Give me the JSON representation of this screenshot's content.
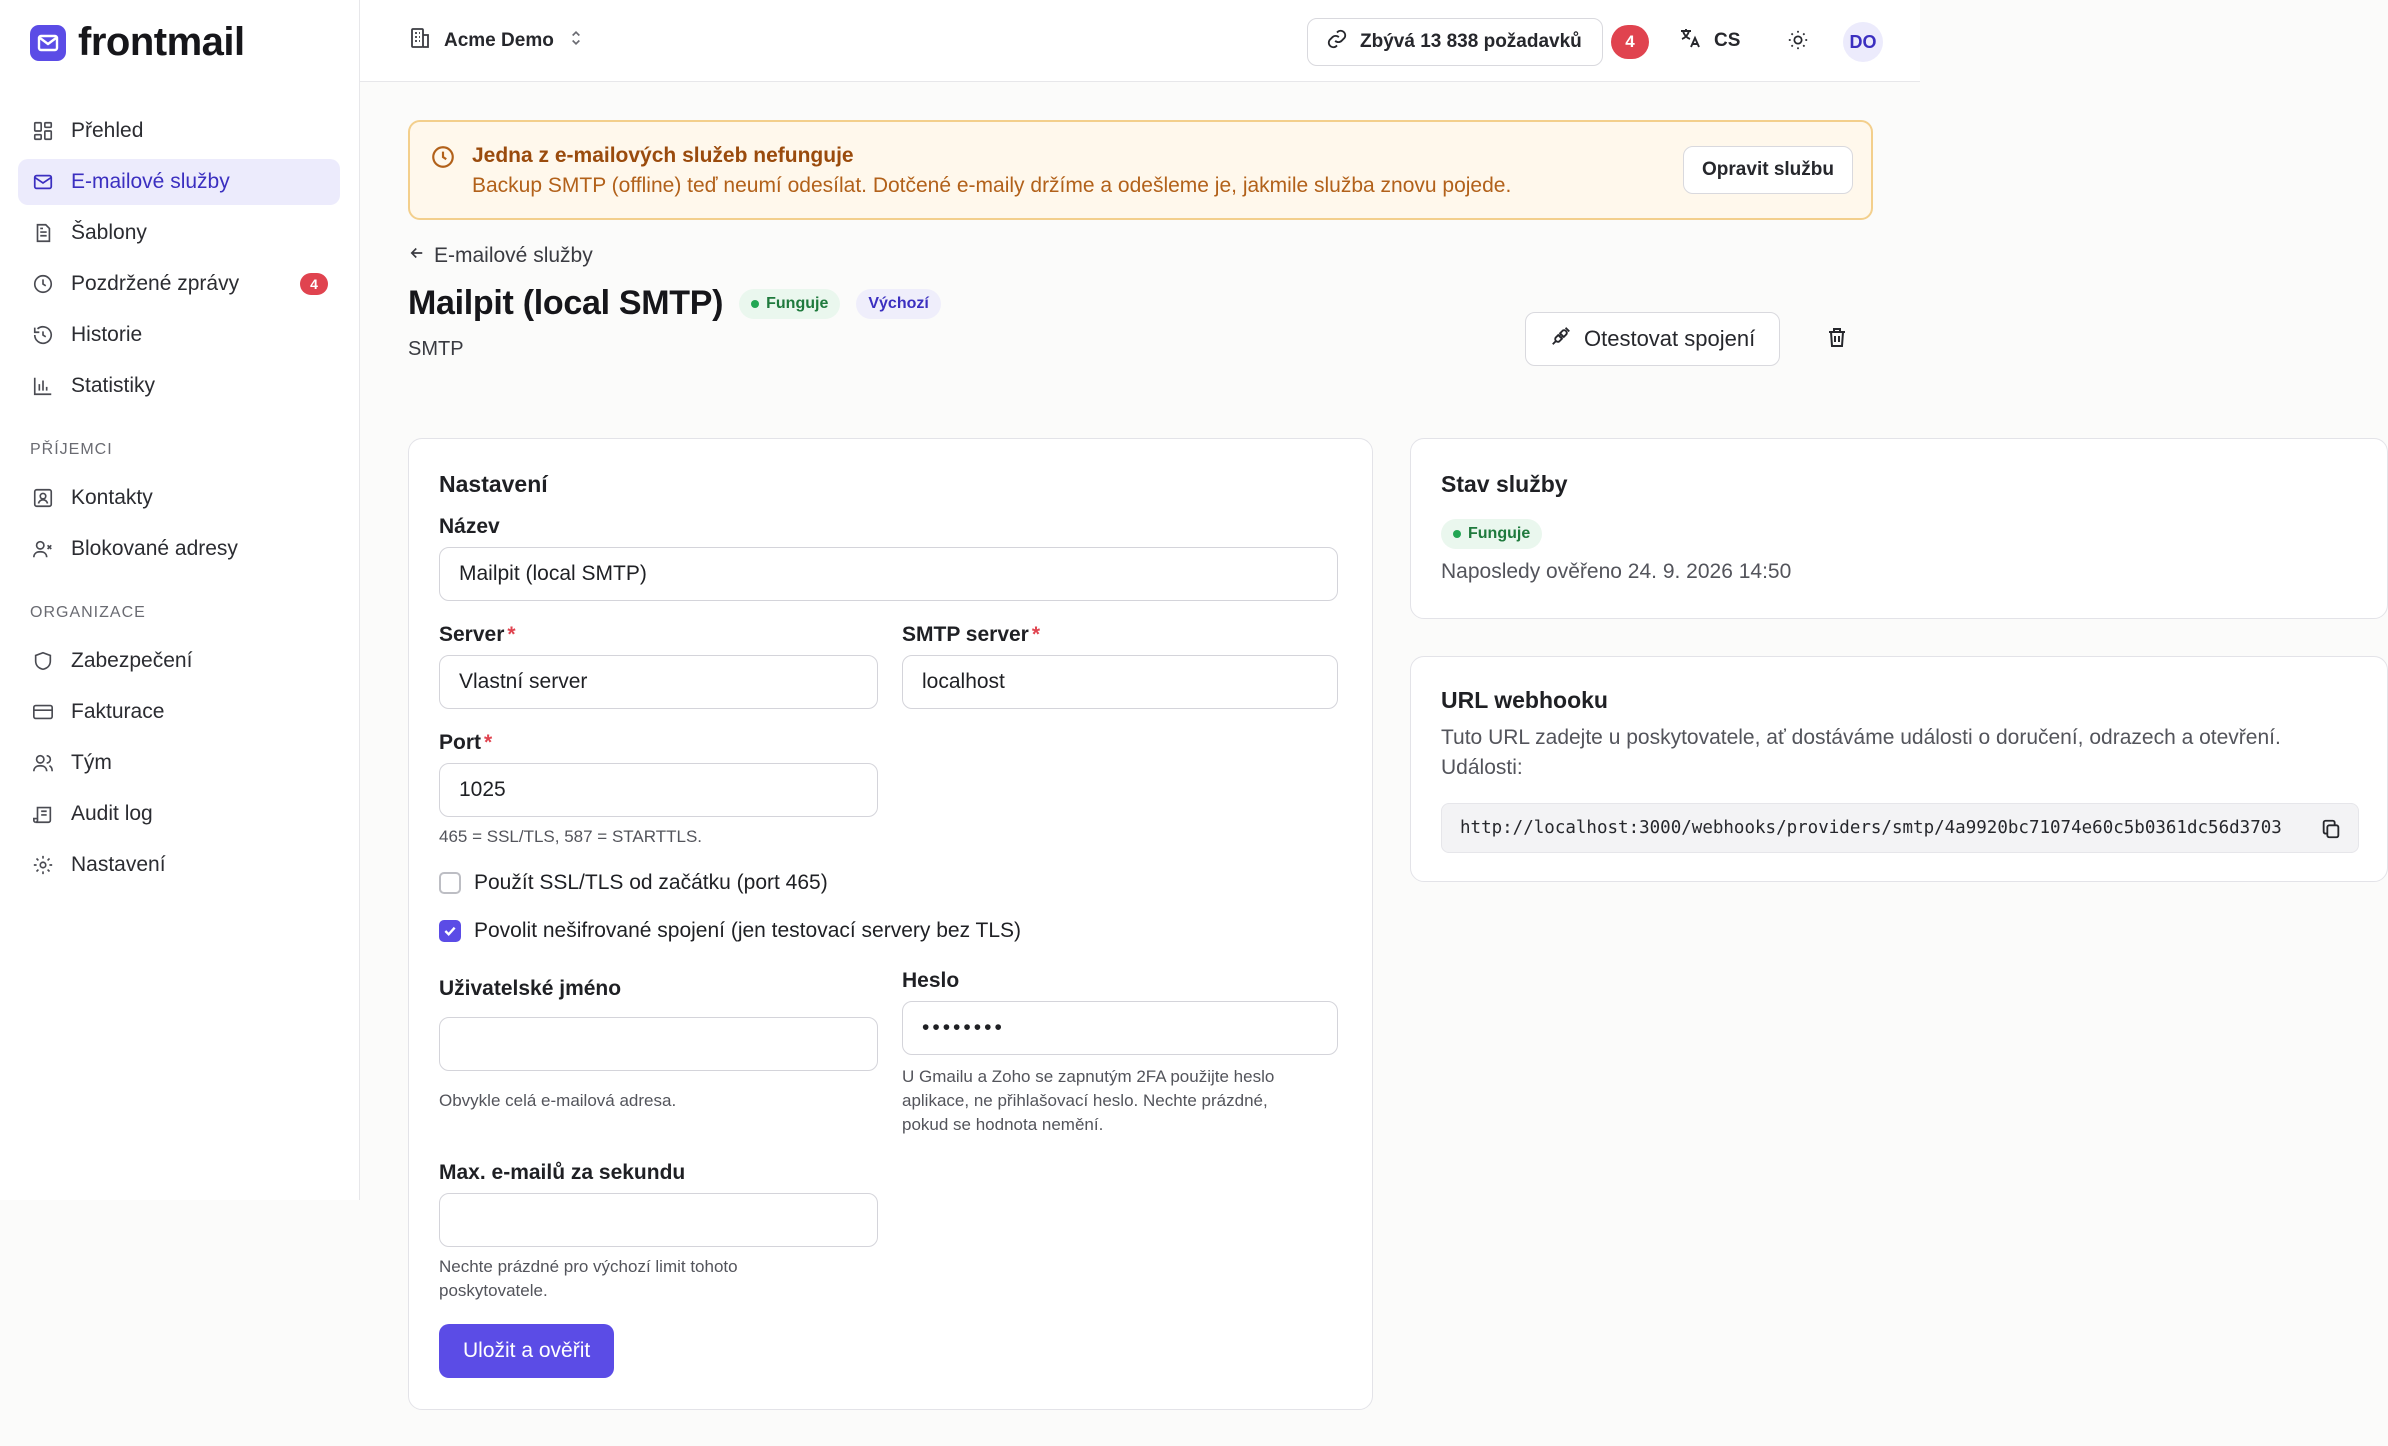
{
  "app": {
    "brand_name": "frontmail",
    "accent_color": "#5b4ce6",
    "danger_color": "#e0434f"
  },
  "sidebar": {
    "items": [
      {
        "label": "Přehled",
        "icon": "dashboard-icon"
      },
      {
        "label": "E-mailové služby",
        "icon": "mail-icon",
        "active": true
      },
      {
        "label": "Šablony",
        "icon": "template-icon"
      },
      {
        "label": "Pozdržené zprávy",
        "icon": "clock-icon",
        "badge": "4"
      },
      {
        "label": "Historie",
        "icon": "history-icon"
      },
      {
        "label": "Statistiky",
        "icon": "bar-chart-icon"
      }
    ],
    "section_recipients": "PŘÍJEMCI",
    "recipient_items": [
      {
        "label": "Kontakty",
        "icon": "contact-icon"
      },
      {
        "label": "Blokované adresy",
        "icon": "user-x-icon"
      }
    ],
    "section_org": "ORGANIZACE",
    "org_items": [
      {
        "label": "Zabezpečení",
        "icon": "shield-icon"
      },
      {
        "label": "Fakturace",
        "icon": "credit-card-icon"
      },
      {
        "label": "Tým",
        "icon": "users-icon"
      },
      {
        "label": "Audit log",
        "icon": "scroll-icon"
      },
      {
        "label": "Nastavení",
        "icon": "gear-icon"
      }
    ]
  },
  "topbar": {
    "org_name": "Acme Demo",
    "quota_label": "Zbývá 13 838 požadavků",
    "notification_count": "4",
    "language": "CS",
    "avatar_initials": "DO"
  },
  "alert": {
    "title": "Jedna z e-mailových služeb nefunguje",
    "text": "Backup SMTP (offline) teď neumí odesílat. Dotčené e-maily držíme a odešleme je, jakmile služba znovu pojede.",
    "button": "Opravit službu"
  },
  "header": {
    "back_label": "E-mailové služby",
    "title": "Mailpit (local SMTP)",
    "status_badge": "Funguje",
    "default_badge": "Výchozí",
    "subtitle": "SMTP",
    "test_button": "Otestovat spojení"
  },
  "settings": {
    "title": "Nastavení",
    "name_label": "Název",
    "name_value": "Mailpit (local SMTP)",
    "server_label": "Server",
    "server_value": "Vlastní server",
    "smtp_label": "SMTP server",
    "smtp_value": "localhost",
    "port_label": "Port",
    "port_value": "1025",
    "port_hint": "465 = SSL/TLS, 587 = STARTTLS.",
    "ssl_label": "Použít SSL/TLS od začátku (port 465)",
    "ssl_checked": false,
    "unencrypted_label": "Povolit nešifrované spojení (jen testovací servery bez TLS)",
    "unencrypted_checked": true,
    "username_label": "Uživatelské jméno",
    "username_value": "",
    "username_hint": "Obvykle celá e-mailová adresa.",
    "password_label": "Heslo",
    "password_value": "••••••••",
    "password_hint_1": "U Gmailu a Zoho se zapnutým 2FA použijte heslo",
    "password_hint_2": "aplikace, ne přihlašovací heslo. Nechte prázdné,",
    "password_hint_3": "pokud se hodnota nemění.",
    "rate_label": "Max. e-mailů za sekundu",
    "rate_value": "",
    "rate_hint_1": "Nechte prázdné pro výchozí limit tohoto",
    "rate_hint_2": "poskytovatele.",
    "save_button": "Uložit a ověřit"
  },
  "status": {
    "title": "Stav služby",
    "badge": "Funguje",
    "last_checked": "Naposledy ověřeno 24. 9. 2026 14:50"
  },
  "webhook": {
    "title": "URL webhooku",
    "description": "Tuto URL zadejte u poskytovatele, ať dostáváme události o doručení, odrazech a otevření. Události:",
    "url": "http://localhost:3000/webhooks/providers/smtp/4a9920bc71074e60c5b0361dc56d3703"
  }
}
